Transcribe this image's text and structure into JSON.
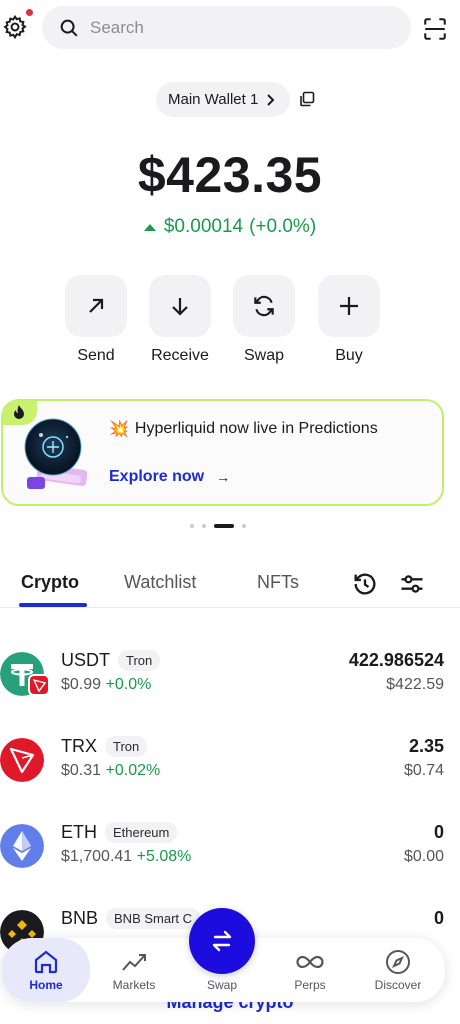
{
  "header": {
    "search_placeholder": "Search",
    "settings_icon": "gear-icon",
    "scan_icon": "scan-icon"
  },
  "wallet": {
    "name": "Main Wallet 1",
    "balance": "$423.35",
    "change_amount": "$0.00014",
    "change_pct": "(+0.0%)"
  },
  "actions": [
    {
      "label": "Send",
      "icon": "arrow-up-right-icon"
    },
    {
      "label": "Receive",
      "icon": "arrow-down-icon"
    },
    {
      "label": "Swap",
      "icon": "swap-icon"
    },
    {
      "label": "Buy",
      "icon": "plus-icon"
    }
  ],
  "promo": {
    "emoji": "💥",
    "title": "Hyperliquid now live in Predictions",
    "link": "Explore now",
    "link_arrow": "→"
  },
  "tabs": [
    {
      "label": "Crypto",
      "active": true
    },
    {
      "label": "Watchlist",
      "active": false
    },
    {
      "label": "NFTs",
      "active": false
    }
  ],
  "assets": [
    {
      "symbol": "USDT",
      "chain": "Tron",
      "price": "$0.99",
      "change": "+0.0%",
      "qty": "422.986524",
      "value": "$422.59"
    },
    {
      "symbol": "TRX",
      "chain": "Tron",
      "price": "$0.31",
      "change": "+0.02%",
      "qty": "2.35",
      "value": "$0.74"
    },
    {
      "symbol": "ETH",
      "chain": "Ethereum",
      "price": "$1,700.41",
      "change": "+5.08%",
      "qty": "0",
      "value": "$0.00"
    },
    {
      "symbol": "BNB",
      "chain": "BNB Smart C",
      "price": "",
      "change": "",
      "qty": "0",
      "value": ""
    }
  ],
  "manage_label": "Manage crypto",
  "nav": [
    {
      "label": "Home",
      "active": true
    },
    {
      "label": "Markets",
      "active": false
    },
    {
      "label": "Swap",
      "active": false
    },
    {
      "label": "Perps",
      "active": false
    },
    {
      "label": "Discover",
      "active": false
    }
  ],
  "colors": {
    "accent": "#1c2bd4",
    "positive": "#1a9a4c",
    "promo_border": "#bff06a",
    "fab": "#1c0dde"
  }
}
